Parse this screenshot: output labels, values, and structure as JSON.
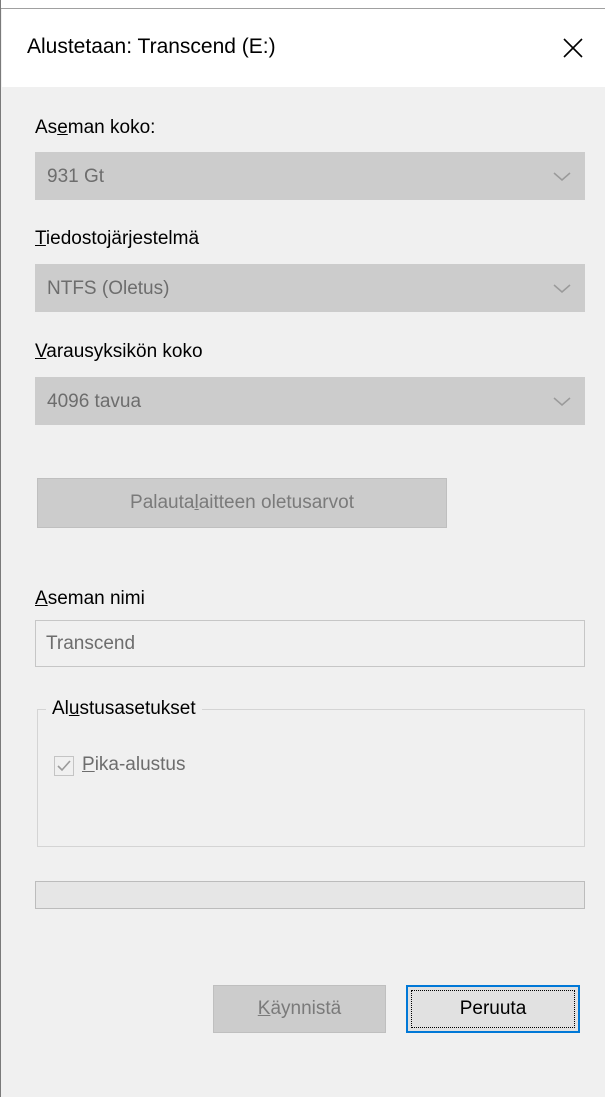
{
  "window": {
    "title": "Alustetaan: Transcend (E:)"
  },
  "capacity": {
    "label_pre": "As",
    "label_mn": "e",
    "label_post": "man koko:",
    "value": "931 Gt"
  },
  "filesystem": {
    "label_mn": "T",
    "label_post": "iedostojärjestelmä",
    "value": "NTFS (Oletus)"
  },
  "allocation": {
    "label_mn": "V",
    "label_post": "arausyksikön koko",
    "value": "4096 tavua"
  },
  "restore_button": {
    "label_pre": "Palauta ",
    "label_mn": "l",
    "label_post": "aitteen oletusarvot"
  },
  "volume_label": {
    "label_mn": "A",
    "label_post": "seman nimi",
    "value": "Transcend"
  },
  "format_options": {
    "legend_pre": "Al",
    "legend_mn": "u",
    "legend_post": "stusasetukset",
    "quick_format": {
      "label_mn": "P",
      "label_post": "ika-alustus",
      "checked": true
    }
  },
  "progress": {
    "value": 0
  },
  "buttons": {
    "start_mn": "K",
    "start_post": "äynnistä",
    "cancel": "Peruuta"
  }
}
